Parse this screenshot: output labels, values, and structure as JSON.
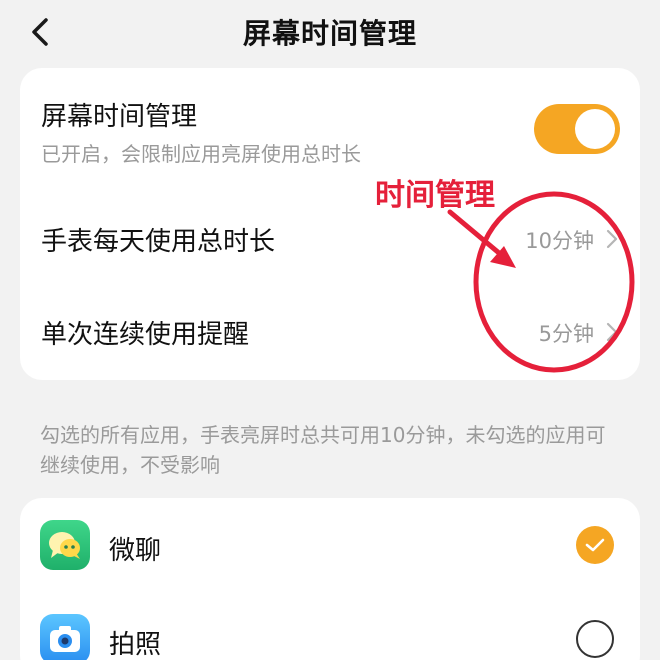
{
  "header": {
    "title": "屏幕时间管理",
    "back_icon": "chevron-left-icon"
  },
  "settings": {
    "toggle": {
      "title": "屏幕时间管理",
      "subtitle": "已开启，会限制应用亮屏使用总时长",
      "enabled": true
    },
    "daily": {
      "label": "手表每天使用总时长",
      "value": "10分钟"
    },
    "continuous": {
      "label": "单次连续使用提醒",
      "value": "5分钟"
    }
  },
  "hint": "勾选的所有应用，手表亮屏时总共可用10分钟，未勾选的应用可继续使用，不受影响",
  "apps": [
    {
      "name": "微聊",
      "icon": "chat-bubbles-icon",
      "checked": true
    },
    {
      "name": "拍照",
      "icon": "camera-icon",
      "checked": false
    }
  ],
  "annotation": {
    "text": "时间管理"
  },
  "colors": {
    "accent": "#f5a623",
    "annotation": "#e5203a",
    "background": "#f2f2f2",
    "secondary_text": "#9a9a9a"
  }
}
